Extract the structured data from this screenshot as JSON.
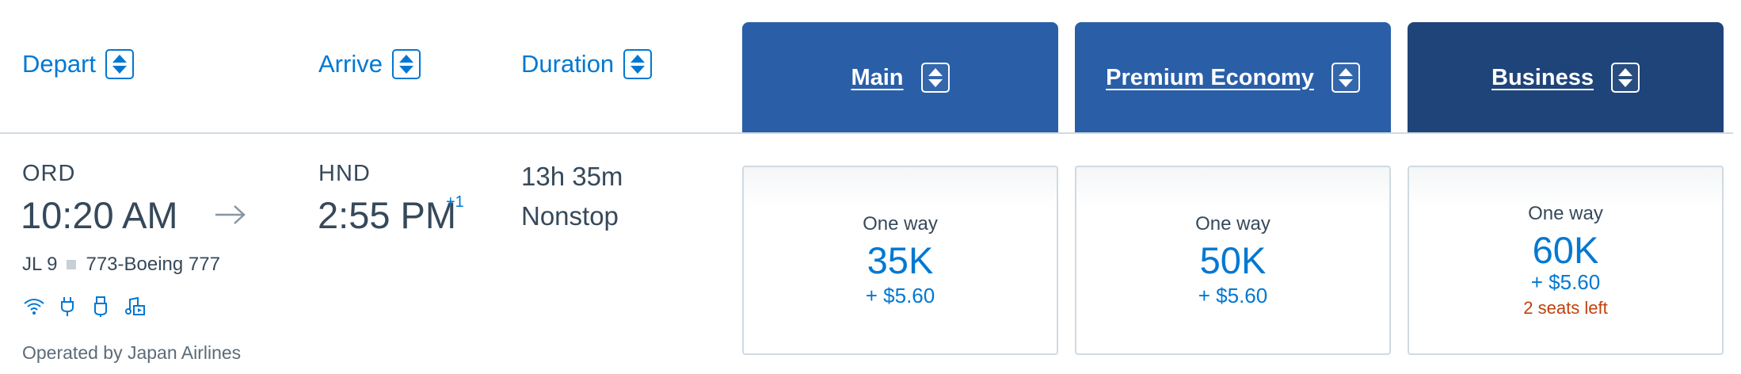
{
  "headers": {
    "depart": "Depart",
    "arrive": "Arrive",
    "duration": "Duration"
  },
  "cabins": [
    {
      "label": "Main",
      "color": "#2a5fa8"
    },
    {
      "label": "Premium Economy",
      "color": "#2a5fa8"
    },
    {
      "label": "Business",
      "color": "#1f4479"
    }
  ],
  "flight": {
    "origin": "ORD",
    "depart_time": "10:20 AM",
    "destination": "HND",
    "arrive_time": "2:55 PM",
    "day_offset": "+1",
    "duration": "13h 35m",
    "stops": "Nonstop",
    "flight_number": "JL 9",
    "aircraft": "773-Boeing 777",
    "amenities": [
      "wifi-icon",
      "power-outlet-icon",
      "usb-icon",
      "entertainment-icon"
    ],
    "operated_by": "Operated by Japan Airlines"
  },
  "fares": [
    {
      "label": "One way",
      "miles": "35K",
      "taxes": "+ $5.60",
      "seats": ""
    },
    {
      "label": "One way",
      "miles": "50K",
      "taxes": "+ $5.60",
      "seats": ""
    },
    {
      "label": "One way",
      "miles": "60K",
      "taxes": "+ $5.60",
      "seats": "2 seats left"
    }
  ],
  "colors": {
    "accent": "#0078d2",
    "text": "#36495a",
    "warning": "#c2410c"
  }
}
